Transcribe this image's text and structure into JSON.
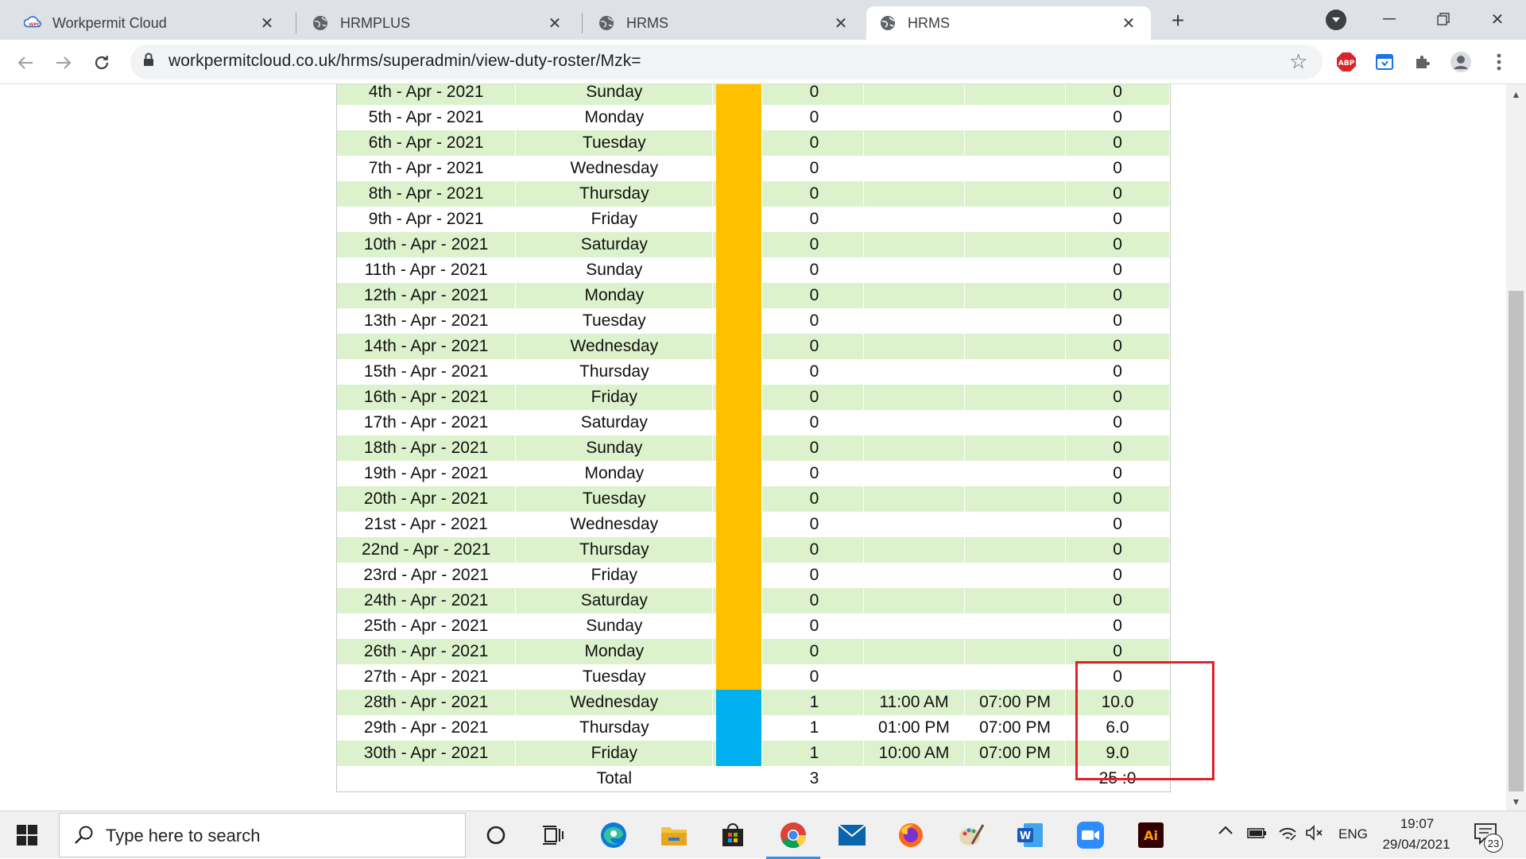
{
  "browser": {
    "tabs": [
      {
        "title": "Workpermit Cloud",
        "icon": "workpermit-cloud-icon",
        "active": false
      },
      {
        "title": "HRMPLUS",
        "icon": "globe-icon",
        "active": false
      },
      {
        "title": "HRMS",
        "icon": "globe-icon",
        "active": false
      },
      {
        "title": "HRMS",
        "icon": "globe-icon",
        "active": true
      }
    ],
    "url": "workpermitcloud.co.uk/hrms/superadmin/view-duty-roster/Mzk="
  },
  "roster": {
    "rows": [
      {
        "date": "4th - Apr - 2021",
        "day": "Sunday",
        "color": "#ffc000",
        "shifts": "0",
        "in": "",
        "out": "",
        "hours": "0"
      },
      {
        "date": "5th - Apr - 2021",
        "day": "Monday",
        "color": "#ffc000",
        "shifts": "0",
        "in": "",
        "out": "",
        "hours": "0"
      },
      {
        "date": "6th - Apr - 2021",
        "day": "Tuesday",
        "color": "#ffc000",
        "shifts": "0",
        "in": "",
        "out": "",
        "hours": "0"
      },
      {
        "date": "7th - Apr - 2021",
        "day": "Wednesday",
        "color": "#ffc000",
        "shifts": "0",
        "in": "",
        "out": "",
        "hours": "0"
      },
      {
        "date": "8th - Apr - 2021",
        "day": "Thursday",
        "color": "#ffc000",
        "shifts": "0",
        "in": "",
        "out": "",
        "hours": "0"
      },
      {
        "date": "9th - Apr - 2021",
        "day": "Friday",
        "color": "#ffc000",
        "shifts": "0",
        "in": "",
        "out": "",
        "hours": "0"
      },
      {
        "date": "10th - Apr - 2021",
        "day": "Saturday",
        "color": "#ffc000",
        "shifts": "0",
        "in": "",
        "out": "",
        "hours": "0"
      },
      {
        "date": "11th - Apr - 2021",
        "day": "Sunday",
        "color": "#ffc000",
        "shifts": "0",
        "in": "",
        "out": "",
        "hours": "0"
      },
      {
        "date": "12th - Apr - 2021",
        "day": "Monday",
        "color": "#ffc000",
        "shifts": "0",
        "in": "",
        "out": "",
        "hours": "0"
      },
      {
        "date": "13th - Apr - 2021",
        "day": "Tuesday",
        "color": "#ffc000",
        "shifts": "0",
        "in": "",
        "out": "",
        "hours": "0"
      },
      {
        "date": "14th - Apr - 2021",
        "day": "Wednesday",
        "color": "#ffc000",
        "shifts": "0",
        "in": "",
        "out": "",
        "hours": "0"
      },
      {
        "date": "15th - Apr - 2021",
        "day": "Thursday",
        "color": "#ffc000",
        "shifts": "0",
        "in": "",
        "out": "",
        "hours": "0"
      },
      {
        "date": "16th - Apr - 2021",
        "day": "Friday",
        "color": "#ffc000",
        "shifts": "0",
        "in": "",
        "out": "",
        "hours": "0"
      },
      {
        "date": "17th - Apr - 2021",
        "day": "Saturday",
        "color": "#ffc000",
        "shifts": "0",
        "in": "",
        "out": "",
        "hours": "0"
      },
      {
        "date": "18th - Apr - 2021",
        "day": "Sunday",
        "color": "#ffc000",
        "shifts": "0",
        "in": "",
        "out": "",
        "hours": "0"
      },
      {
        "date": "19th - Apr - 2021",
        "day": "Monday",
        "color": "#ffc000",
        "shifts": "0",
        "in": "",
        "out": "",
        "hours": "0"
      },
      {
        "date": "20th - Apr - 2021",
        "day": "Tuesday",
        "color": "#ffc000",
        "shifts": "0",
        "in": "",
        "out": "",
        "hours": "0"
      },
      {
        "date": "21st - Apr - 2021",
        "day": "Wednesday",
        "color": "#ffc000",
        "shifts": "0",
        "in": "",
        "out": "",
        "hours": "0"
      },
      {
        "date": "22nd - Apr - 2021",
        "day": "Thursday",
        "color": "#ffc000",
        "shifts": "0",
        "in": "",
        "out": "",
        "hours": "0"
      },
      {
        "date": "23rd - Apr - 2021",
        "day": "Friday",
        "color": "#ffc000",
        "shifts": "0",
        "in": "",
        "out": "",
        "hours": "0"
      },
      {
        "date": "24th - Apr - 2021",
        "day": "Saturday",
        "color": "#ffc000",
        "shifts": "0",
        "in": "",
        "out": "",
        "hours": "0"
      },
      {
        "date": "25th - Apr - 2021",
        "day": "Sunday",
        "color": "#ffc000",
        "shifts": "0",
        "in": "",
        "out": "",
        "hours": "0"
      },
      {
        "date": "26th - Apr - 2021",
        "day": "Monday",
        "color": "#ffc000",
        "shifts": "0",
        "in": "",
        "out": "",
        "hours": "0"
      },
      {
        "date": "27th - Apr - 2021",
        "day": "Tuesday",
        "color": "#ffc000",
        "shifts": "0",
        "in": "",
        "out": "",
        "hours": "0"
      },
      {
        "date": "28th - Apr - 2021",
        "day": "Wednesday",
        "color": "#00b0f0",
        "shifts": "1",
        "in": "11:00 AM",
        "out": "07:00 PM",
        "hours": "10.0"
      },
      {
        "date": "29th - Apr - 2021",
        "day": "Thursday",
        "color": "#00b0f0",
        "shifts": "1",
        "in": "01:00 PM",
        "out": "07:00 PM",
        "hours": "6.0"
      },
      {
        "date": "30th - Apr - 2021",
        "day": "Friday",
        "color": "#00b0f0",
        "shifts": "1",
        "in": "10:00 AM",
        "out": "07:00 PM",
        "hours": "9.0"
      }
    ],
    "total": {
      "label": "Total",
      "shifts": "3",
      "hours": "25 :0"
    }
  },
  "taskbar": {
    "search_placeholder": "Type here to search",
    "apps": [
      "cortana-icon",
      "task-view-icon",
      "edge-icon",
      "file-explorer-icon",
      "store-icon",
      "chrome-icon",
      "mail-icon",
      "firefox-icon",
      "paint-icon",
      "word-icon",
      "zoom-icon",
      "illustrator-icon"
    ],
    "language": "ENG",
    "time": "19:07",
    "date": "29/04/2021",
    "notifications": "23"
  }
}
